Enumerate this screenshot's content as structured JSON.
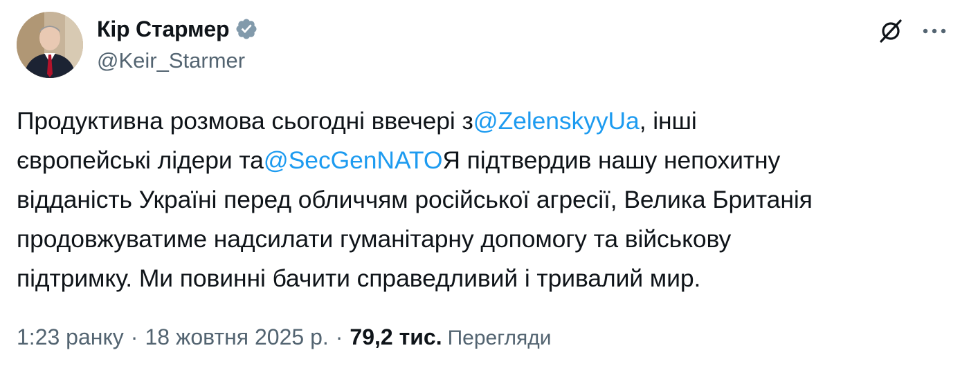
{
  "author": {
    "display_name": "Кір Стармер",
    "handle": "@Keir_Starmer",
    "verified": true,
    "avatar_icon": "profile-photo"
  },
  "actions": {
    "grok_icon": "grok-icon",
    "more_icon": "more-horizontal-icon"
  },
  "text": {
    "line1_a": "Продуктивна розмова сьогодні ввечері з",
    "mention1": "@ZelenskyyUa",
    "line1_b": ", інші",
    "line2_a": "європейські лідери та",
    "mention2": "@SecGenNATO",
    "line2_b": "Я підтвердив нашу непохитну",
    "line3": "відданість Україні перед обличчям російської агресії, Велика Британія",
    "line4": "продовжуватиме надсилати гуманітарну допомогу та військову",
    "line5": "підтримку. Ми повинні бачити справедливий і тривалий мир."
  },
  "meta": {
    "time": "1:23 ранку",
    "sep1": "·",
    "date": "18 жовтня 2025 р.",
    "sep2": "·",
    "views_count": "79,2 тис.",
    "views_label": "Перегляди"
  },
  "colors": {
    "link": "#1d9bf0",
    "secondary": "#536471",
    "primary_text": "#0f1419",
    "verified_badge": "#829aab"
  }
}
